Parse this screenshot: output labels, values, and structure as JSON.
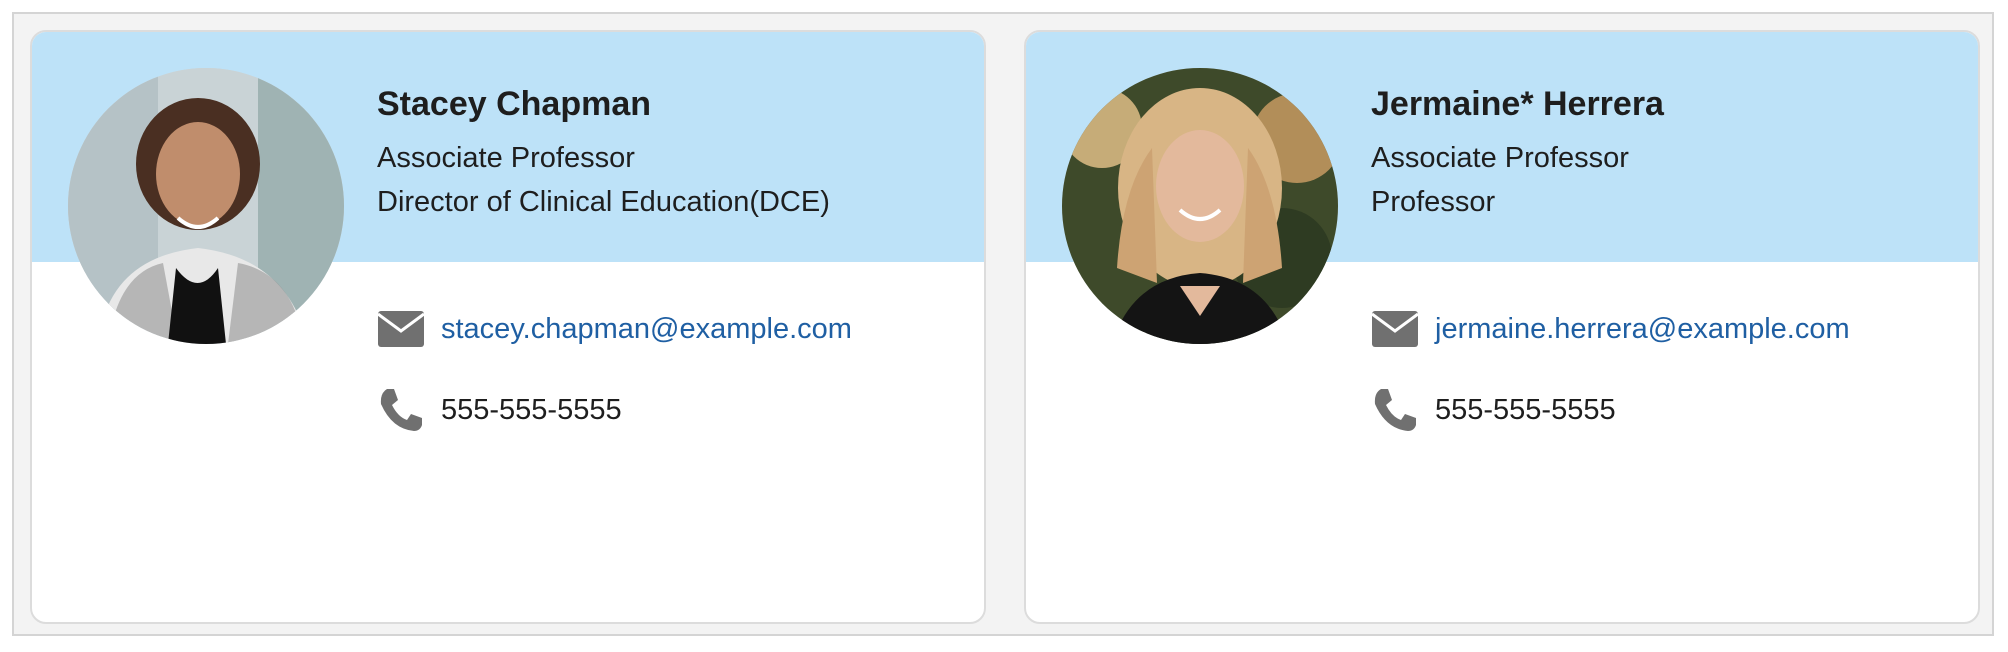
{
  "colors": {
    "header_band": "#bde2f8",
    "email_link": "#1f5fa3",
    "icon_gray": "#707070"
  },
  "cards": [
    {
      "name": "Stacey Chapman",
      "titles": [
        "Associate Professor",
        "Director of Clinical Education(DCE)"
      ],
      "email": "stacey.chapman@example.com",
      "phone": "555-555-5555",
      "photo": "portrait-photo",
      "email_icon": "envelope-icon",
      "phone_icon": "phone-icon"
    },
    {
      "name": "Jermaine* Herrera",
      "titles": [
        "Associate Professor",
        "Professor"
      ],
      "email": "jermaine.herrera@example.com",
      "phone": "555-555-5555",
      "photo": "portrait-photo",
      "email_icon": "envelope-icon",
      "phone_icon": "phone-icon"
    }
  ]
}
